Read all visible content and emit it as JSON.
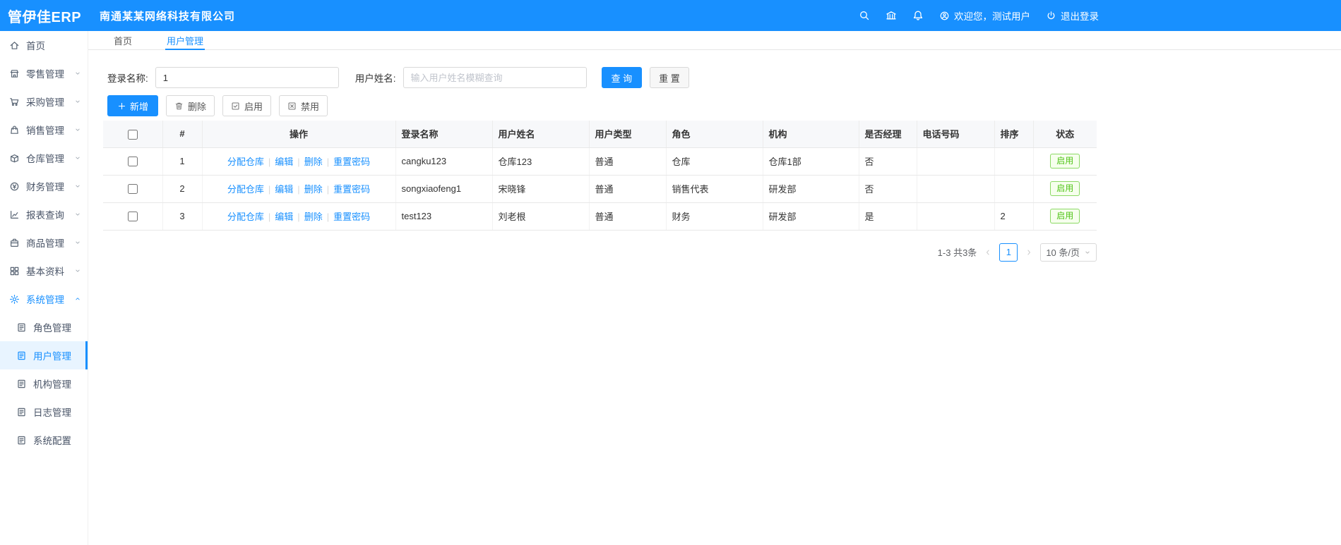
{
  "topbar": {
    "logo": "管伊佳ERP",
    "company": "南通某某网络科技有限公司",
    "welcome": "欢迎您，测试用户",
    "logout": "退出登录"
  },
  "tabs": {
    "home": "首页",
    "current": "用户管理"
  },
  "sidebar": {
    "items": [
      {
        "label": "首页"
      },
      {
        "label": "零售管理"
      },
      {
        "label": "采购管理"
      },
      {
        "label": "销售管理"
      },
      {
        "label": "仓库管理"
      },
      {
        "label": "财务管理"
      },
      {
        "label": "报表查询"
      },
      {
        "label": "商品管理"
      },
      {
        "label": "基本资料"
      },
      {
        "label": "系统管理"
      }
    ],
    "submenu": [
      {
        "label": "角色管理"
      },
      {
        "label": "用户管理"
      },
      {
        "label": "机构管理"
      },
      {
        "label": "日志管理"
      },
      {
        "label": "系统配置"
      }
    ]
  },
  "search": {
    "login_label": "登录名称:",
    "login_value": "1",
    "name_label": "用户姓名:",
    "name_placeholder": "输入用户姓名模糊查询",
    "query": "查 询",
    "reset": "重 置"
  },
  "toolbar": {
    "add": "新增",
    "delete": "删除",
    "enable": "启用",
    "disable": "禁用"
  },
  "table": {
    "headers": {
      "index": "#",
      "action": "操作",
      "login": "登录名称",
      "name": "用户姓名",
      "type": "用户类型",
      "role": "角色",
      "org": "机构",
      "manager": "是否经理",
      "phone": "电话号码",
      "sort": "排序",
      "status": "状态"
    },
    "actions": {
      "assign": "分配仓库",
      "edit": "编辑",
      "del": "删除",
      "reset_pwd": "重置密码",
      "sep": "|"
    },
    "rows": [
      {
        "index": "1",
        "login": "cangku123",
        "name": "仓库123",
        "type": "普通",
        "role": "仓库",
        "org": "仓库1部",
        "manager": "否",
        "phone": "",
        "sort": "",
        "status": "启用"
      },
      {
        "index": "2",
        "login": "songxiaofeng1",
        "name": "宋晓锋",
        "type": "普通",
        "role": "销售代表",
        "org": "研发部",
        "manager": "否",
        "phone": "",
        "sort": "",
        "status": "启用"
      },
      {
        "index": "3",
        "login": "test123",
        "name": "刘老根",
        "type": "普通",
        "role": "财务",
        "org": "研发部",
        "manager": "是",
        "phone": "",
        "sort": "2",
        "status": "启用"
      }
    ]
  },
  "pagination": {
    "summary": "1-3 共3条",
    "page": "1",
    "page_size": "10 条/页"
  },
  "colors": {
    "primary": "#1890ff",
    "success": "#52c41a"
  }
}
